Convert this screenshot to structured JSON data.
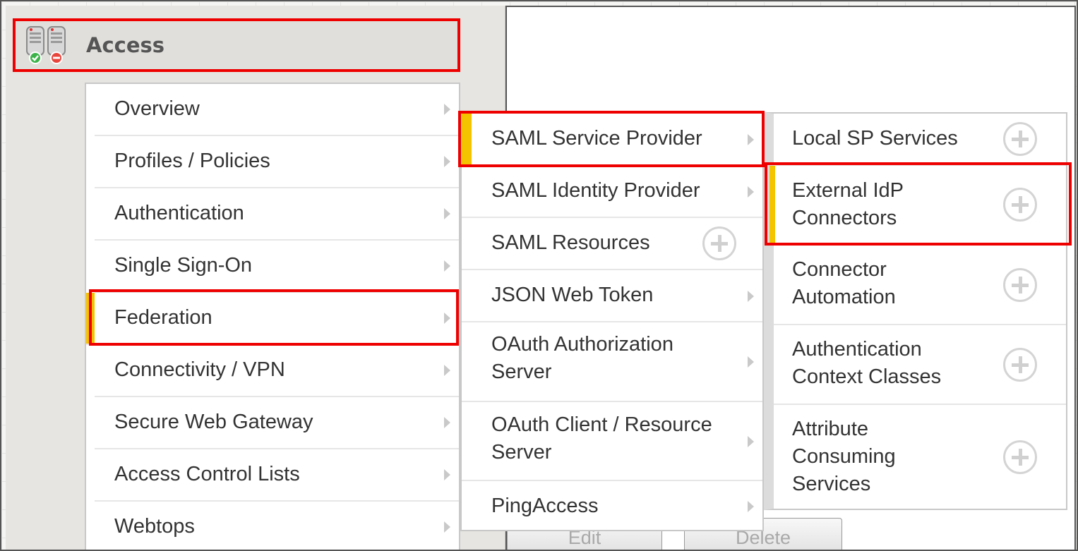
{
  "header": {
    "title": "Access",
    "icon": "server-status-icon"
  },
  "menu1": {
    "items": [
      {
        "label": "Overview"
      },
      {
        "label": "Profiles / Policies"
      },
      {
        "label": "Authentication"
      },
      {
        "label": "Single Sign-On"
      },
      {
        "label": "Federation",
        "selected": true
      },
      {
        "label": "Connectivity / VPN"
      },
      {
        "label": "Secure Web Gateway"
      },
      {
        "label": "Access Control Lists"
      },
      {
        "label": "Webtops"
      }
    ]
  },
  "menu2": {
    "items": [
      {
        "label": "SAML Service Provider",
        "selected": true
      },
      {
        "label": "SAML Identity Provider"
      },
      {
        "label": "SAML Resources"
      },
      {
        "label": "JSON Web Token"
      },
      {
        "label_line1": "OAuth Authorization",
        "label_line2": "Server"
      },
      {
        "label_line1": "OAuth Client / Resource",
        "label_line2": "Server"
      },
      {
        "label": "PingAccess"
      }
    ]
  },
  "menu3": {
    "items": [
      {
        "label": "Local SP Services"
      },
      {
        "label_line1": "External IdP",
        "label_line2": "Connectors",
        "selected": true
      },
      {
        "label_line1": "Connector",
        "label_line2": "Automation"
      },
      {
        "label_line1": "Authentication",
        "label_line2": "Context Classes"
      },
      {
        "label_line1": "Attribute",
        "label_line2": "Consuming",
        "label_line3": "Services"
      }
    ]
  },
  "buttons": {
    "edit": "Edit",
    "delete": "Delete"
  },
  "colors": {
    "highlight": "#ee0000",
    "accent": "#f5c400",
    "panel": "#e6e5e1"
  }
}
